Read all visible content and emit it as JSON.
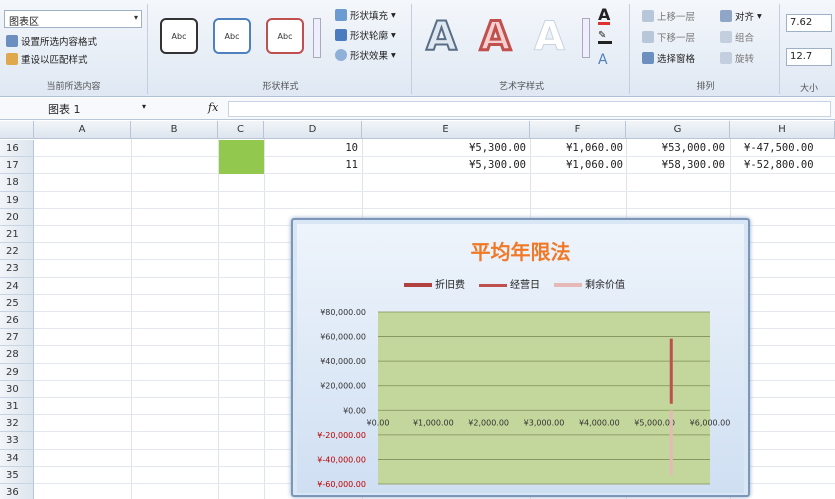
{
  "ribbon": {
    "chart_element": "图表区",
    "cmd_format_selection": "设置所选内容格式",
    "cmd_reset_style": "重设以匹配样式",
    "group_current_selection": "当前所选内容",
    "shape_swatch_label": "Abc",
    "cmd_shape_fill": "形状填充",
    "cmd_shape_outline": "形状轮廓",
    "cmd_shape_effects": "形状效果",
    "group_shape_styles": "形状样式",
    "wordart_letter": "A",
    "group_wordart": "艺术字样式",
    "cmd_bring_forward": "上移一层",
    "cmd_send_backward": "下移一层",
    "cmd_selection_pane": "选择窗格",
    "cmd_align": "对齐",
    "cmd_group": "组合",
    "cmd_rotate": "旋转",
    "group_arrange": "排列",
    "height_value": "7.62",
    "width_value": "12.7",
    "group_size": "大小"
  },
  "formula_bar": {
    "name_box": "图表 1",
    "fx": "fx"
  },
  "columns": [
    "A",
    "B",
    "C",
    "D",
    "E",
    "F",
    "G",
    "H"
  ],
  "rows": [
    "16",
    "17",
    "18",
    "19",
    "20",
    "21",
    "22",
    "23",
    "24",
    "25",
    "26",
    "27",
    "28",
    "29",
    "30",
    "31",
    "32",
    "33",
    "34",
    "35",
    "36"
  ],
  "cells": {
    "d16": "10",
    "e16": "¥5,300.00",
    "f16": "¥1,060.00",
    "g16": "¥53,000.00",
    "h16": "¥-47,500.00",
    "d17": "11",
    "e17": "¥5,300.00",
    "f17": "¥1,060.00",
    "g17": "¥58,300.00",
    "h17": "¥-52,800.00"
  },
  "colors": {
    "c16_fill": "#92c84e",
    "plot_area": "#c3d69b",
    "series_depreciation": "#c0504d",
    "series_accumulated": "#c0504d",
    "series_residual": "#e6b9b8",
    "title": "#f07826",
    "negative_label": "#c00000"
  },
  "chart_data": {
    "type": "line",
    "title": "平均年限法",
    "legend": [
      "折旧费",
      "经营日",
      "剩余价值"
    ],
    "legend_position": "top",
    "y_ticks": [
      "¥80,000.00",
      "¥60,000.00",
      "¥40,000.00",
      "¥20,000.00",
      "¥0.00",
      "¥-20,000.00",
      "¥-40,000.00",
      "¥-60,000.00"
    ],
    "x_ticks": [
      "¥0.00",
      "¥1,000.00",
      "¥2,000.00",
      "¥3,000.00",
      "¥4,000.00",
      "¥5,000.00",
      "¥6,000.00"
    ],
    "ylim": [
      -60000,
      80000
    ],
    "xlim": [
      0,
      6000
    ],
    "grid": true,
    "series": [
      {
        "name": "折旧费",
        "x": [
          5300,
          5300
        ],
        "y": [
          5300,
          58300
        ],
        "color": "#c0504d"
      },
      {
        "name": "剩余价值",
        "x": [
          5300,
          5300
        ],
        "y": [
          -52800,
          0
        ],
        "color": "#e6b9b8"
      }
    ]
  }
}
